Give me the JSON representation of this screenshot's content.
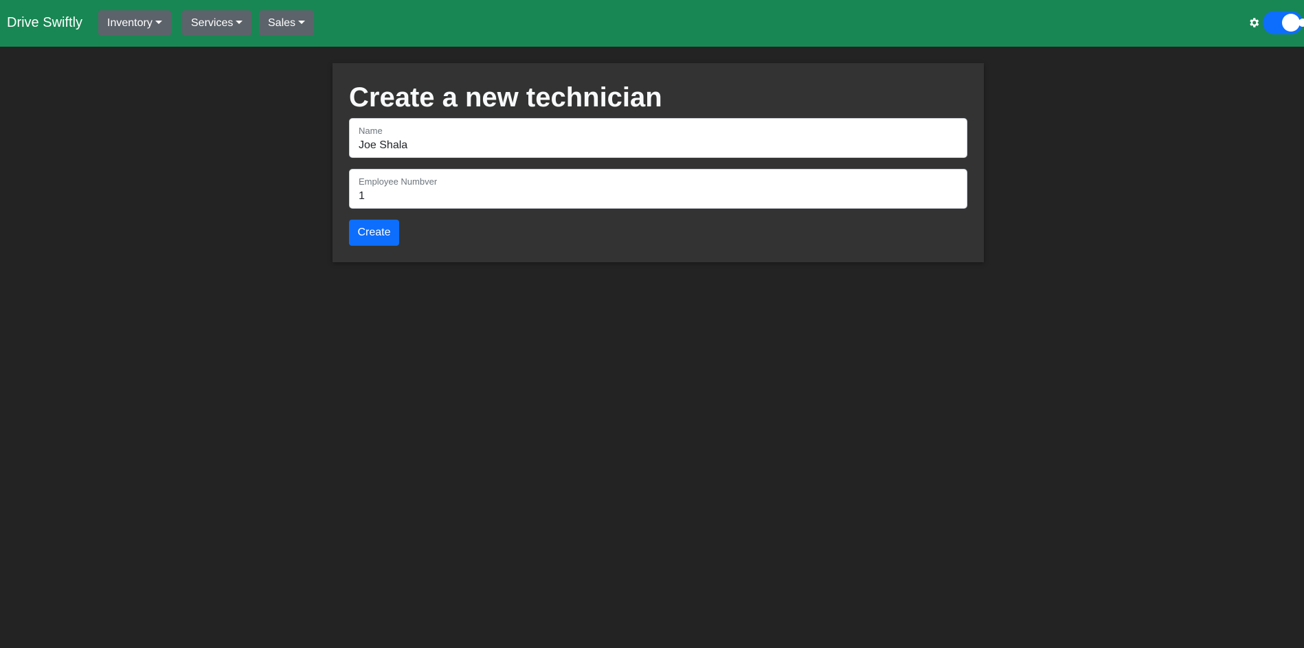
{
  "navbar": {
    "brand": "Drive Swiftly",
    "menus": [
      {
        "label": "Inventory"
      },
      {
        "label": "Services"
      },
      {
        "label": "Sales"
      }
    ],
    "theme_toggle": {
      "icon": "gear-icon",
      "state": "on"
    },
    "color": "#198754"
  },
  "form": {
    "title": "Create a new technician",
    "fields": [
      {
        "label": "Name",
        "value": "Joe Shala"
      },
      {
        "label": "Employee Numbver",
        "value": "1"
      }
    ],
    "submit_label": "Create"
  },
  "colors": {
    "page_background": "#232323",
    "card_background": "#333333",
    "primary": "#0d6efd",
    "nav_button": "#5c636a"
  }
}
